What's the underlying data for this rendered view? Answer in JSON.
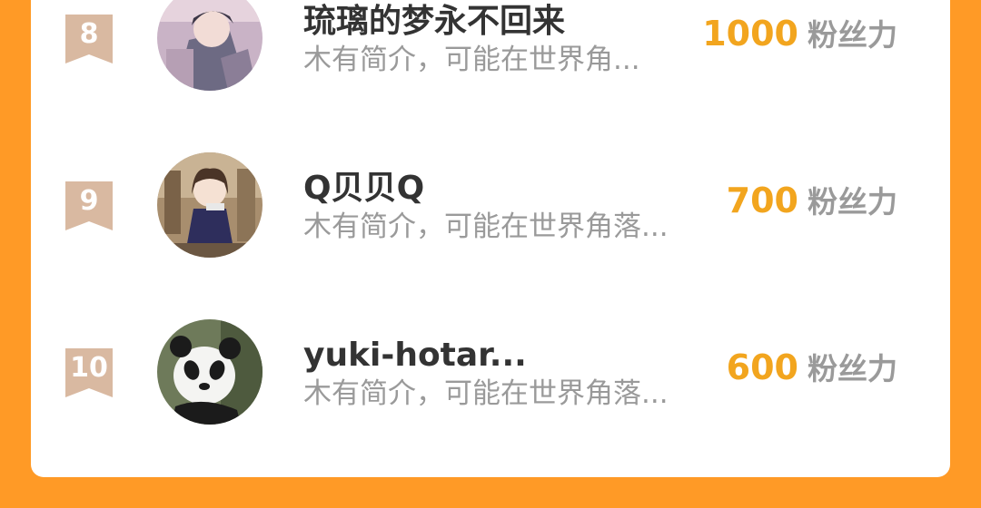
{
  "ranking": {
    "fans_label": "粉丝力",
    "rank_badge_color": "#D9B9A1",
    "fans_value_color": "#F2A51E",
    "rows": [
      {
        "rank": "8",
        "name": "琉璃的梦永不回来",
        "intro": "木有简介，可能在世界角...",
        "fans": "1000",
        "avatar_icon": "anime-boy-avatar-icon"
      },
      {
        "rank": "9",
        "name": "Q贝贝Q",
        "intro": "木有简介，可能在世界角落...",
        "fans": "700",
        "avatar_icon": "anime-girl-avatar-icon"
      },
      {
        "rank": "10",
        "name": "yuki-hotar...",
        "intro": "木有简介，可能在世界角落...",
        "fans": "600",
        "avatar_icon": "panda-avatar-icon"
      }
    ]
  }
}
